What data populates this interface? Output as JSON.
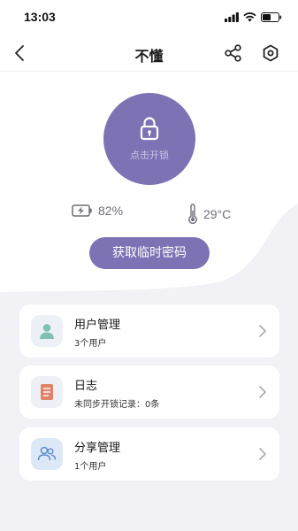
{
  "status_bar": {
    "time": "13:03"
  },
  "nav": {
    "title": "不懂"
  },
  "lock": {
    "label": "点击开锁"
  },
  "stats": {
    "battery": "82%",
    "temperature": "29°C"
  },
  "temp_password_button": "获取临时密码",
  "cards": [
    {
      "title": "用户管理",
      "subtitle": "3个用户",
      "icon": "user-icon"
    },
    {
      "title": "日志",
      "subtitle": "未同步开锁记录：0条",
      "icon": "log-icon"
    },
    {
      "title": "分享管理",
      "subtitle": "1个用户",
      "icon": "share-users-icon"
    }
  ],
  "colors": {
    "accent": "#7c72b4",
    "background": "#f2f2f6",
    "card": "#ffffff",
    "user_icon": "#7fc0b4",
    "log_icon": "#e2826a",
    "share_icon": "#5f8fcf"
  }
}
